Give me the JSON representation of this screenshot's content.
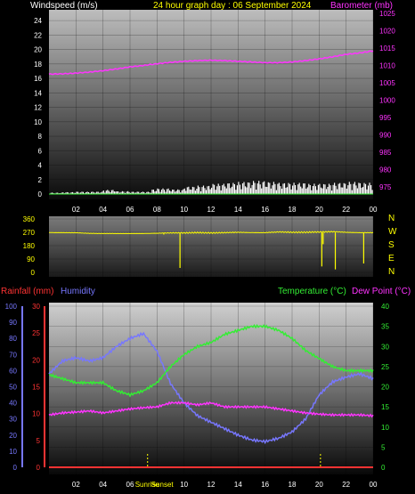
{
  "title": "24 hour graph day : 06 September 2024",
  "colors": {
    "background": "#000000",
    "wind": "#ffffff",
    "barometer": "#ff33ff",
    "direction": "#ffff00",
    "rainfall": "#ff3333",
    "humidity": "#7777ff",
    "temperature": "#33ee33",
    "dewpoint": "#ff33ff",
    "sun": "#ffff00"
  },
  "x_ticks": [
    "02",
    "04",
    "06",
    "08",
    "10",
    "12",
    "14",
    "16",
    "18",
    "20",
    "22",
    "00"
  ],
  "sun_labels": {
    "sunrise": "Sunrise",
    "sunset": "Sunset"
  },
  "chart_data": [
    {
      "type": "line",
      "panel": "wind_baro",
      "left_axis_label": "Windspeed (m/s)",
      "right_axis_label": "Barometer (mb)",
      "ylim_left": [
        0,
        25
      ],
      "yticks_left": [
        "0",
        "2",
        "4",
        "6",
        "8",
        "10",
        "12",
        "14",
        "16",
        "18",
        "20",
        "22",
        "24"
      ],
      "ylim_right": [
        973,
        1025
      ],
      "yticks_right": [
        "975",
        "980",
        "985",
        "990",
        "995",
        "1000",
        "1005",
        "1010",
        "1015",
        "1020",
        "1025"
      ],
      "x": [
        0,
        1,
        2,
        3,
        4,
        5,
        6,
        7,
        8,
        9,
        10,
        11,
        12,
        13,
        14,
        15,
        16,
        17,
        18,
        19,
        20,
        21,
        22,
        23,
        24
      ],
      "series": [
        {
          "name": "Barometer (mb)",
          "axis": "right",
          "values": [
            1007.5,
            1007.6,
            1007.8,
            1008.1,
            1008.5,
            1009,
            1009.6,
            1010,
            1010.5,
            1010.9,
            1011.2,
            1011.4,
            1011.5,
            1011.4,
            1011.2,
            1011,
            1010.8,
            1010.8,
            1011,
            1011.4,
            1011.9,
            1012.5,
            1013.2,
            1013.6,
            1014.2
          ]
        },
        {
          "name": "Windspeed (m/s)",
          "axis": "left",
          "values": [
            0.3,
            0.4,
            0.5,
            0.5,
            0.9,
            0.6,
            0.5,
            0.5,
            0.6,
            0.5,
            0.8,
            0.9,
            1.1,
            1.2,
            1.3,
            1.4,
            1.3,
            1.2,
            1.2,
            1.1,
            1.1,
            1.2,
            1.3,
            1.2,
            1.0
          ]
        }
      ]
    },
    {
      "type": "line",
      "panel": "wind_direction",
      "right_axis_label": "N W S E N",
      "direction_labels": [
        "N",
        "W",
        "S",
        "E",
        "N"
      ],
      "ylim_left": [
        0,
        360
      ],
      "yticks_left": [
        "0",
        "90",
        "180",
        "270",
        "360"
      ],
      "x": [
        0,
        1,
        2,
        3,
        4,
        5,
        6,
        7,
        8,
        9,
        10,
        11,
        12,
        13,
        14,
        15,
        16,
        17,
        18,
        19,
        20,
        21,
        22,
        23,
        24
      ],
      "series": [
        {
          "name": "Wind direction",
          "values": [
            268,
            268,
            267,
            263,
            262,
            262,
            262,
            262,
            264,
            266,
            266,
            268,
            266,
            268,
            270,
            268,
            268,
            272,
            270,
            270,
            272,
            274,
            270,
            268,
            268
          ]
        }
      ]
    },
    {
      "type": "line",
      "panel": "temp_hum_rain",
      "left_axis_label": "Rainfall (mm)",
      "left_axis_label_2": "Humidity",
      "right_axis_label": "Temperature (°C)",
      "right_axis_label_2": "Dew Point (°C)",
      "ylim_left_rain": [
        0,
        30
      ],
      "yticks_rain": [
        "0",
        "5",
        "10",
        "15",
        "20",
        "25",
        "30"
      ],
      "ylim_left_hum": [
        0,
        100
      ],
      "yticks_hum": [
        "0",
        "10",
        "20",
        "30",
        "40",
        "50",
        "60",
        "70",
        "80",
        "90",
        "100"
      ],
      "ylim_right": [
        0,
        40
      ],
      "yticks_right": [
        "0",
        "5",
        "10",
        "15",
        "20",
        "25",
        "30",
        "35",
        "40"
      ],
      "x": [
        0,
        1,
        2,
        3,
        4,
        5,
        6,
        7,
        8,
        9,
        10,
        11,
        12,
        13,
        14,
        15,
        16,
        17,
        18,
        19,
        20,
        21,
        22,
        23,
        24
      ],
      "series": [
        {
          "name": "Humidity",
          "axis": "humidity",
          "values": [
            58,
            66,
            68,
            66,
            68,
            75,
            80,
            83,
            72,
            52,
            40,
            32,
            28,
            24,
            20,
            17,
            16,
            18,
            22,
            30,
            45,
            53,
            56,
            58,
            55
          ]
        },
        {
          "name": "Temperature (°C)",
          "axis": "right",
          "values": [
            23,
            22,
            21,
            21,
            21,
            19,
            18,
            19,
            21,
            25,
            28,
            30,
            31,
            33,
            34,
            35,
            35,
            34,
            32,
            29,
            27,
            25,
            24,
            24,
            24
          ]
        },
        {
          "name": "Dew Point (°C)",
          "axis": "right",
          "values": [
            13,
            13.5,
            13.7,
            14,
            13.5,
            14,
            14.5,
            14.8,
            15,
            16,
            16,
            15.5,
            16,
            15,
            15,
            15,
            15,
            14.5,
            14,
            13.5,
            13.2,
            13,
            13,
            13,
            12.8
          ]
        },
        {
          "name": "Rainfall (mm)",
          "axis": "rain",
          "values": [
            0,
            0,
            0,
            0,
            0,
            0,
            0,
            0,
            0,
            0,
            0,
            0,
            0,
            0,
            0,
            0,
            0,
            0,
            0,
            0,
            0,
            0,
            0,
            0,
            0
          ]
        }
      ],
      "sun_marks_hours": [
        7.3,
        20.1
      ]
    }
  ]
}
